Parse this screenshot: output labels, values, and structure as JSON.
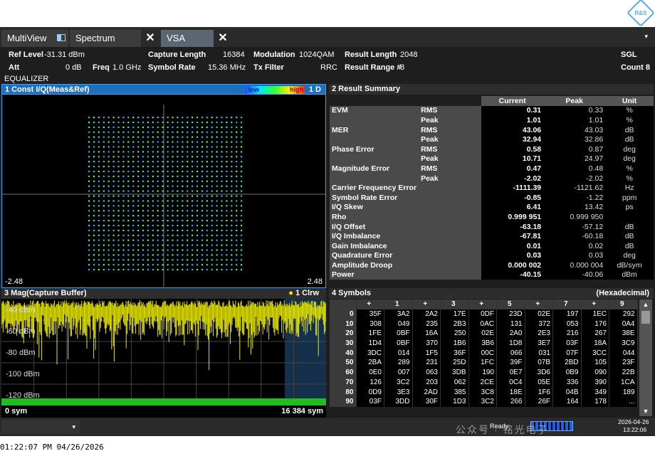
{
  "tabs": [
    {
      "label": "MultiView"
    },
    {
      "label": "Spectrum"
    },
    {
      "label": "VSA"
    }
  ],
  "logo_text": "R&S",
  "params": {
    "ref_level_label": "Ref Level",
    "ref_level_value": "-31.31 dBm",
    "att_label": "Att",
    "att_value": "0 dB",
    "freq_label": "Freq",
    "freq_value": "1.0 GHz",
    "capture_length_label": "Capture Length",
    "capture_length_value": "16384",
    "symbol_rate_label": "Symbol Rate",
    "symbol_rate_value": "15.36 MHz",
    "modulation_label": "Modulation",
    "modulation_value": "1024QAM",
    "tx_filter_label": "Tx Filter",
    "tx_filter_value": "RRC",
    "result_length_label": "Result Length",
    "result_length_value": "2048",
    "result_range_label": "Result Range #",
    "result_range_value": "8",
    "sgl": "SGL",
    "count": "Count 8",
    "equalizer": "EQUALIZER"
  },
  "const_window": {
    "title": "1 Const I/Q(Meas&Ref)",
    "legend_low": "low",
    "legend_high": "high",
    "trace": "1 D",
    "x_min": "-2.48",
    "x_max": "2.48",
    "grid_points": 32,
    "colors": {
      "dots": "#2ec6a8",
      "background": "#000000"
    }
  },
  "result_summary": {
    "title": "2 Result Summary",
    "columns": [
      "Current",
      "Peak",
      "Unit"
    ],
    "rows": [
      {
        "group": "EVM",
        "label": "RMS",
        "current": "0.31",
        "peak": "0.33",
        "unit": "%"
      },
      {
        "group": "",
        "label": "Peak",
        "current": "1.01",
        "peak": "1.01",
        "unit": "%"
      },
      {
        "group": "MER",
        "label": "RMS",
        "current": "43.06",
        "peak": "43.03",
        "unit": "dB"
      },
      {
        "group": "",
        "label": "Peak",
        "current": "32.94",
        "peak": "32.86",
        "unit": "dB"
      },
      {
        "group": "Phase Error",
        "label": "RMS",
        "current": "0.58",
        "peak": "0.87",
        "unit": "deg"
      },
      {
        "group": "",
        "label": "Peak",
        "current": "10.71",
        "peak": "24.97",
        "unit": "deg"
      },
      {
        "group": "Magnitude Error",
        "label": "RMS",
        "current": "0.47",
        "peak": "0.48",
        "unit": "%"
      },
      {
        "group": "",
        "label": "Peak",
        "current": "-2.02",
        "peak": "-2.02",
        "unit": "%"
      },
      {
        "group": "Carrier Frequency Error",
        "label": "",
        "current": "-1111.39",
        "peak": "-1121.62",
        "unit": "Hz"
      },
      {
        "group": "Symbol Rate Error",
        "label": "",
        "current": "-0.85",
        "peak": "-1.22",
        "unit": "ppm"
      },
      {
        "group": "I/Q Skew",
        "label": "",
        "current": "6.41",
        "peak": "13.42",
        "unit": "ps"
      },
      {
        "group": "Rho",
        "label": "",
        "current": "0.999 951",
        "peak": "0.999 950",
        "unit": ""
      },
      {
        "group": "I/Q Offset",
        "label": "",
        "current": "-63.18",
        "peak": "-57.12",
        "unit": "dB"
      },
      {
        "group": "I/Q Imbalance",
        "label": "",
        "current": "-67.81",
        "peak": "-60.18",
        "unit": "dB"
      },
      {
        "group": "Gain Imbalance",
        "label": "",
        "current": "0.01",
        "peak": "0.02",
        "unit": "dB"
      },
      {
        "group": "Quadrature Error",
        "label": "",
        "current": "0.03",
        "peak": "0.03",
        "unit": "deg"
      },
      {
        "group": "Amplitude Droop",
        "label": "",
        "current": "0.000 002",
        "peak": "0.000 004",
        "unit": "dB/sym"
      },
      {
        "group": "Power",
        "label": "",
        "current": "-40.15",
        "peak": "-40.06",
        "unit": "dBm"
      }
    ]
  },
  "mag_window": {
    "title": "3 Mag(Capture Buffer)",
    "trace": "1 Clrw",
    "y_labels": [
      "-40 dBm",
      "-60 dBm",
      "-80 dBm",
      "-100 dBm",
      "-120 dBm"
    ],
    "x_min": "0 sym",
    "x_max": "16 384 sym",
    "colors": {
      "trace": "#e8e800",
      "bar": "#22bb22"
    }
  },
  "symbols": {
    "title": "4 Symbols",
    "format": "(Hexadecimal)",
    "headers": [
      "+",
      "1",
      "+",
      "3",
      "+",
      "5",
      "+",
      "7",
      "+",
      "9"
    ],
    "rows": [
      {
        "idx": "0",
        "vals": [
          "35F",
          "3A2",
          "2A2",
          "17E",
          "0DF",
          "23D",
          "02E",
          "197",
          "1EC",
          "292"
        ]
      },
      {
        "idx": "10",
        "vals": [
          "308",
          "049",
          "235",
          "2B3",
          "0AC",
          "131",
          "372",
          "053",
          "176",
          "0A4"
        ]
      },
      {
        "idx": "20",
        "vals": [
          "1FE",
          "0BF",
          "16A",
          "250",
          "02E",
          "2A0",
          "2E3",
          "216",
          "267",
          "38E"
        ]
      },
      {
        "idx": "30",
        "vals": [
          "1D4",
          "0BF",
          "370",
          "1B6",
          "3B6",
          "1D8",
          "3E7",
          "03F",
          "18A",
          "3C9"
        ]
      },
      {
        "idx": "40",
        "vals": [
          "3DC",
          "014",
          "1F5",
          "36F",
          "00C",
          "066",
          "031",
          "07F",
          "3CC",
          "044"
        ]
      },
      {
        "idx": "50",
        "vals": [
          "2BA",
          "289",
          "231",
          "25D",
          "1FC",
          "39F",
          "07B",
          "2BD",
          "105",
          "23F"
        ]
      },
      {
        "idx": "60",
        "vals": [
          "0E0",
          "007",
          "063",
          "3DB",
          "190",
          "0E7",
          "3D6",
          "0B9",
          "090",
          "22B"
        ]
      },
      {
        "idx": "70",
        "vals": [
          "126",
          "3C2",
          "203",
          "062",
          "2CE",
          "0C4",
          "05E",
          "336",
          "390",
          "1CA"
        ]
      },
      {
        "idx": "80",
        "vals": [
          "0D9",
          "3E3",
          "2AD",
          "385",
          "3C8",
          "18E",
          "1F6",
          "04B",
          "349",
          "189"
        ]
      },
      {
        "idx": "90",
        "vals": [
          "03F",
          "3DD",
          "30F",
          "1D3",
          "3C2",
          "266",
          "26F",
          "164",
          "178",
          "..."
        ]
      }
    ]
  },
  "status": {
    "ready": "Ready",
    "date": "2026-04-26",
    "time": "13:22:06",
    "watermark": "公众号 · 铭光电子"
  },
  "footer": {
    "text": "01:22:07 PM  04/26/2026"
  }
}
